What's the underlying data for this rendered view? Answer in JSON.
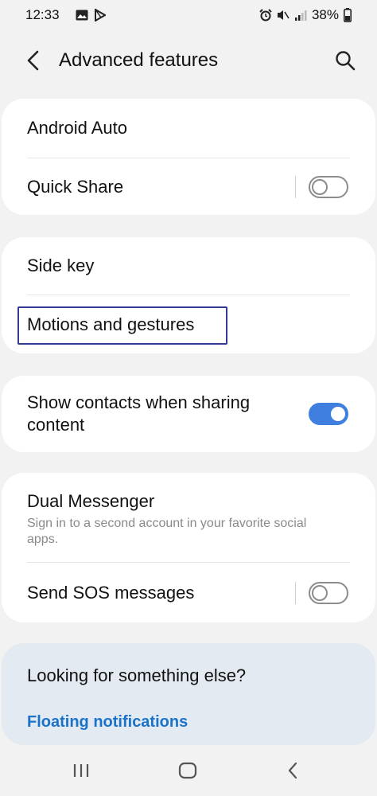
{
  "status": {
    "time": "12:33",
    "battery": "38%"
  },
  "header": {
    "title": "Advanced features"
  },
  "sections": {
    "android_auto": "Android Auto",
    "quick_share": "Quick Share",
    "side_key": "Side key",
    "motions": "Motions and gestures",
    "show_contacts_line1": "Show contacts when sharing",
    "show_contacts_line2": "content",
    "dual_messenger": "Dual Messenger",
    "dual_messenger_sub1": "Sign in to a second account in your favorite social",
    "dual_messenger_sub2": "apps.",
    "send_sos": "Send SOS messages"
  },
  "toggles": {
    "quick_share": "off",
    "show_contacts": "on",
    "send_sos": "off"
  },
  "suggestions": {
    "title": "Looking for something else?",
    "link": "Floating notifications"
  },
  "colors": {
    "accent": "#3e7fe0",
    "link": "#1a73c8",
    "highlight_border": "#2f3b94",
    "background": "#f2f2f2",
    "suggest_bg": "#e4eaf1"
  },
  "icons": {
    "status_left": [
      "image-icon",
      "play-store-icon"
    ],
    "status_right": [
      "alarm-icon",
      "mute-icon",
      "signal-icon",
      "battery-icon"
    ],
    "header": [
      "back-arrow-icon",
      "search-icon"
    ],
    "nav": [
      "recents-icon",
      "home-icon",
      "back-icon"
    ]
  }
}
